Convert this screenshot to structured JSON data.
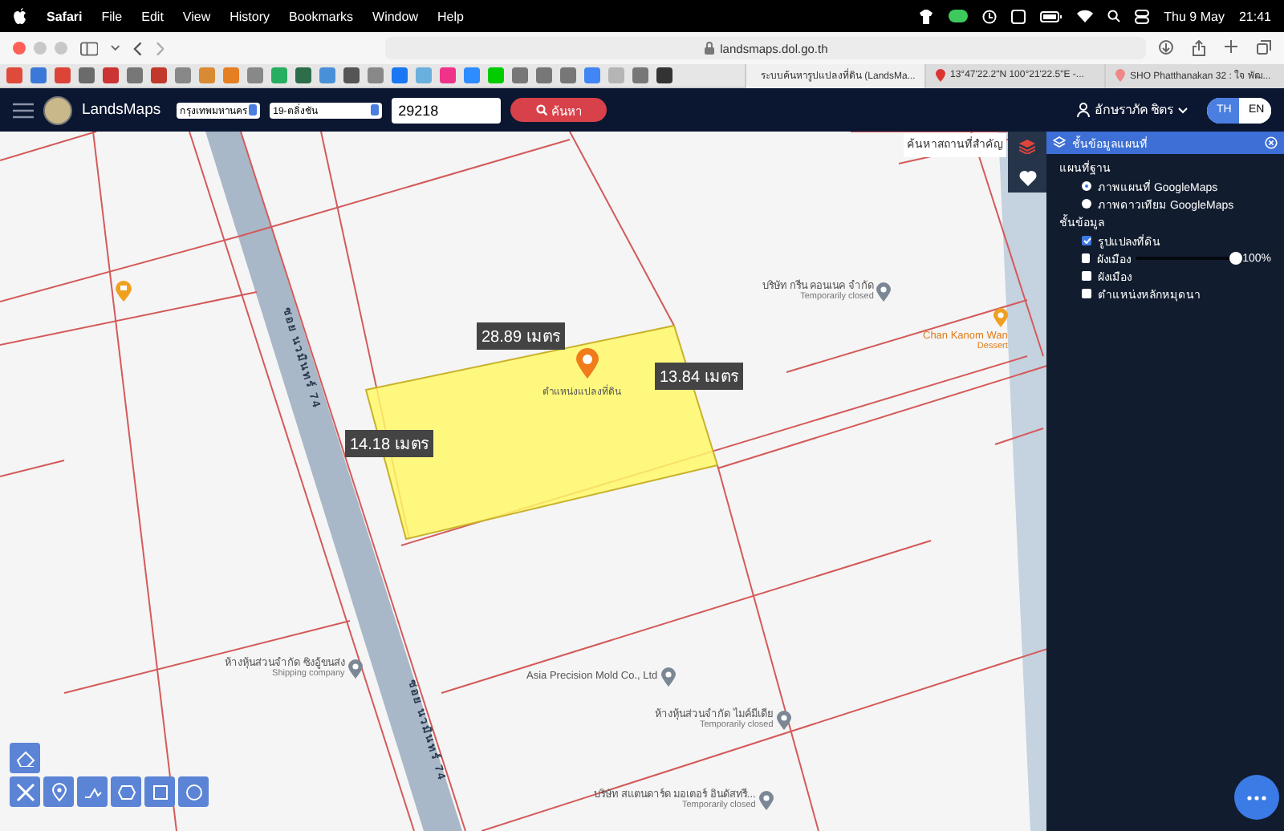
{
  "menubar": {
    "items": [
      {
        "label": "Safari",
        "kind": "app"
      },
      {
        "label": "File",
        "kind": "menu"
      },
      {
        "label": "Edit",
        "kind": "menu"
      },
      {
        "label": "View",
        "kind": "menu"
      },
      {
        "label": "History",
        "kind": "menu"
      },
      {
        "label": "Bookmarks",
        "kind": "menu"
      },
      {
        "label": "Window",
        "kind": "menu"
      },
      {
        "label": "Help",
        "kind": "menu"
      }
    ],
    "date": "Thu 9 May",
    "time": "21:41"
  },
  "browser": {
    "address": "landsmaps.dol.go.th",
    "tabs": [
      {
        "title": "ระบบค้นหารูปแปลงที่ดิน (LandsMa...",
        "selected": true
      },
      {
        "title": "13°47'22.2\"N 100°21'22.5\"E -...",
        "selected": false
      },
      {
        "title": "SHO Phatthanakan 32 : ใจ พัฒ...",
        "selected": false
      }
    ]
  },
  "app": {
    "brand": "LandsMaps",
    "province": "กรุงเทพมหานคร",
    "district": "19-ตลิ่งชัน",
    "parcel_number": "29218",
    "search_button": "ค้นหา",
    "user": "อักษราภัค ชิตร",
    "languages": [
      {
        "label": "TH",
        "selected": true
      },
      {
        "label": "EN",
        "selected": false
      }
    ]
  },
  "map": {
    "place_search": {
      "placeholder": "ค้นหาสถานที่สำคัญ"
    },
    "measurements": [
      {
        "text": "28.89 เมตร"
      },
      {
        "text": "13.84 เมตร"
      },
      {
        "text": "14.18 เมตร"
      }
    ],
    "parcel_label": "ตำแหน่งแปลงที่ดิน",
    "road_labels": [
      "ซอย นวมินทร์ 74",
      "ซอย นวมินทร์ 74"
    ],
    "places": [
      {
        "name": "บริษัท กรีน คอนเนค จำกัด",
        "note": "Temporarily closed",
        "kind": "business"
      },
      {
        "name": "Chan Kanom Wan",
        "note": "Dessert",
        "kind": "food"
      },
      {
        "name": "ห้างหุ้นส่วนจำกัด ซิงอู้ขนส่ง",
        "note": "Shipping company",
        "kind": "business"
      },
      {
        "name": "Asia Precision Mold Co., Ltd",
        "kind": "business"
      },
      {
        "name": "ห้างหุ้นส่วนจำกัด ไมค์มีเดีย",
        "note": "Temporarily closed",
        "kind": "shop"
      },
      {
        "name": "บริษัท สแตนดาร์ด มอเตอร์ อินดัสทรี...",
        "note": "Temporarily closed",
        "kind": "shop"
      }
    ]
  },
  "layer_panel": {
    "title": "ชั้นข้อมูลแผนที่",
    "base_heading": "แผนที่ฐาน",
    "base_maps": [
      {
        "label": "ภาพแผนที่ GoogleMaps",
        "selected": true
      },
      {
        "label": "ภาพดาวเทียม GoogleMaps",
        "selected": false
      }
    ],
    "layer_heading": "ชั้นข้อมูล",
    "layers": [
      {
        "label": "รูปแปลงที่ดิน",
        "checked": true,
        "kind": "check"
      },
      {
        "label": "ผังเมือง",
        "checked": false,
        "kind": "slider",
        "level": 1,
        "reading": "100%"
      },
      {
        "label": "ผังเมือง",
        "checked": false,
        "kind": "check"
      },
      {
        "label": "ตำแหน่งหลักหมุดนา",
        "checked": false,
        "kind": "check"
      }
    ]
  }
}
